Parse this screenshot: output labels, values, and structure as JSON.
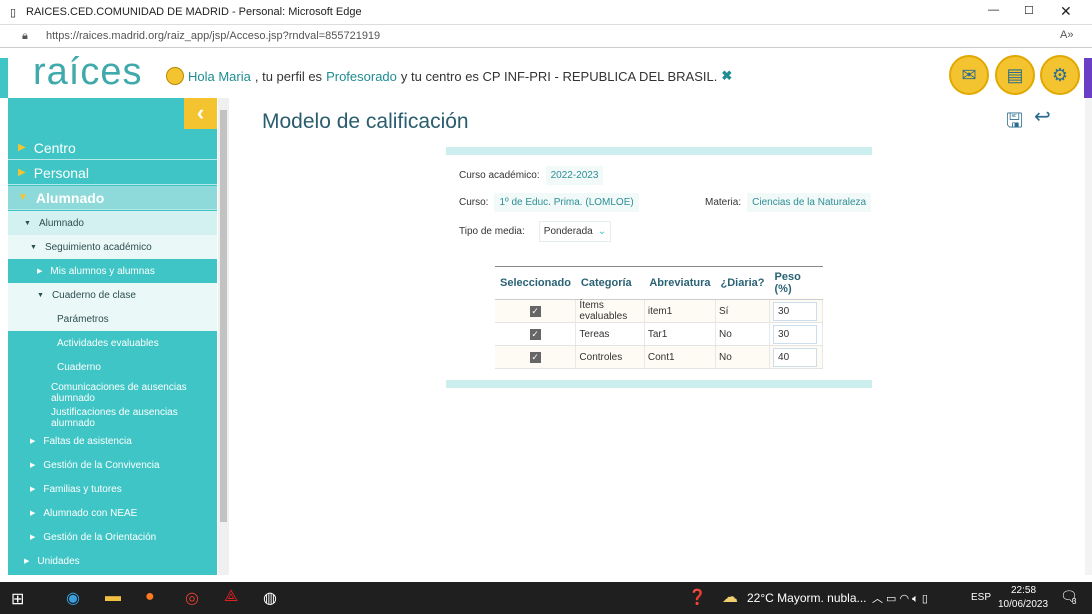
{
  "window": {
    "title": "RAICES.CED.COMUNIDAD DE MADRID - Personal: Microsoft Edge",
    "url": "https://raices.madrid.org/raiz_app/jsp/Acceso.jsp?rndval=855721919"
  },
  "header": {
    "logo": "raíces",
    "hola": "Hola Maria",
    "perfil_pre": ", tu perfil es",
    "perfil": "Profesorado",
    "centro": "y tu centro es CP INF-PRI - REPUBLICA DEL BRASIL."
  },
  "sidebar": {
    "items": [
      {
        "label": "Centro"
      },
      {
        "label": "Personal"
      },
      {
        "label": "Alumnado"
      },
      {
        "label": "Alumnado"
      },
      {
        "label": "Seguimiento académico"
      },
      {
        "label": "Mis alumnos y alumnas"
      },
      {
        "label": "Cuaderno de clase"
      },
      {
        "label": "Parámetros"
      },
      {
        "label": "Actividades evaluables"
      },
      {
        "label": "Cuaderno"
      },
      {
        "label": "Comunicaciones de ausencias alumnado"
      },
      {
        "label": "Justificaciones de ausencias alumnado"
      },
      {
        "label": "Faltas de asistencia"
      },
      {
        "label": "Gestión de la Convivencia"
      },
      {
        "label": "Familias y tutores"
      },
      {
        "label": "Alumnado con NEAE"
      },
      {
        "label": "Gestión de la Orientación"
      },
      {
        "label": "Unidades"
      }
    ]
  },
  "main": {
    "title": "Modelo de calificación",
    "curso_academico_label": "Curso académico:",
    "curso_academico": "2022-2023",
    "curso_label": "Curso:",
    "curso": "1º de Educ. Prima. (LOMLOE)",
    "materia_label": "Materia:",
    "materia": "Ciencias de la Naturaleza",
    "tipo_label": "Tipo de media:",
    "tipo": "Ponderada",
    "table": {
      "headers": [
        "Seleccionado",
        "Categoría",
        "Abreviatura",
        "¿Diaria?",
        "Peso (%)"
      ],
      "rows": [
        {
          "selected": true,
          "categoria": "Ítems evaluables",
          "abreviatura": "item1",
          "diaria": "Sí",
          "peso": "30"
        },
        {
          "selected": true,
          "categoria": "Tereas",
          "abreviatura": "Tar1",
          "diaria": "No",
          "peso": "30"
        },
        {
          "selected": true,
          "categoria": "Controles",
          "abreviatura": "Cont1",
          "diaria": "No",
          "peso": "40"
        }
      ]
    }
  },
  "taskbar": {
    "weather": "22°C  Mayorm. nubla...",
    "lang": "ESP",
    "time": "22:58",
    "date": "10/06/2023",
    "notifications": "3"
  }
}
